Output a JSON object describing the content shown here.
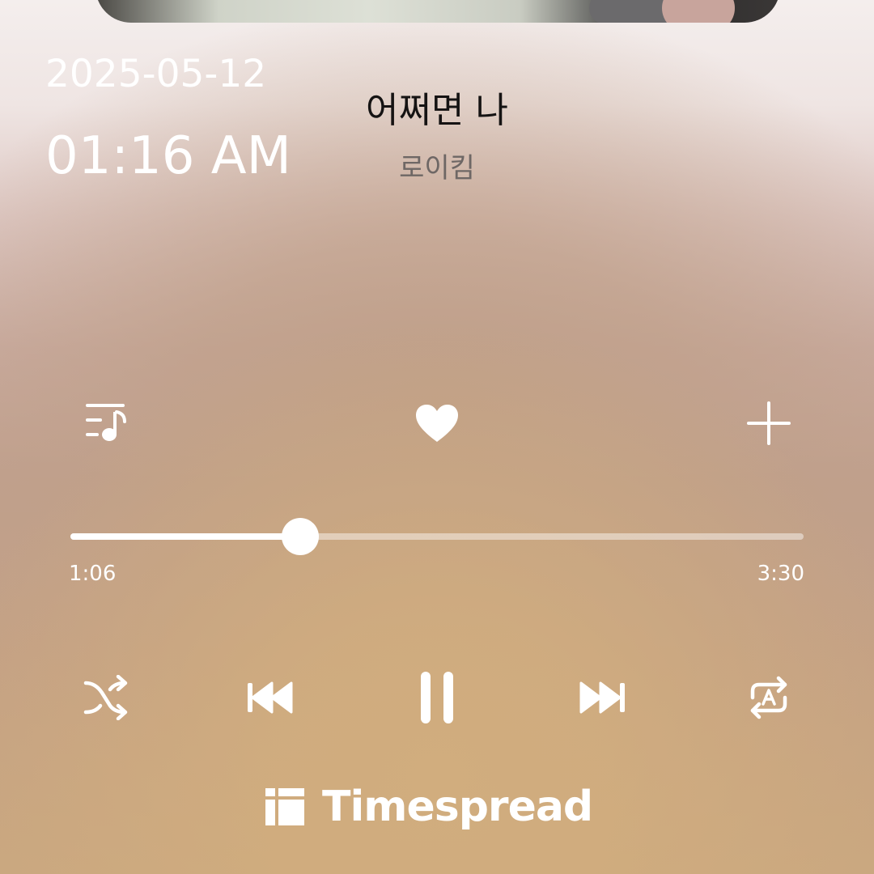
{
  "status": {
    "date": "2025-05-12",
    "time": "01:16 AM"
  },
  "track": {
    "title": "어쩌면 나",
    "artist": "로이킴",
    "liked": true
  },
  "playback": {
    "elapsed": "1:06",
    "duration": "3:30",
    "progress_fraction": 0.314,
    "state": "playing"
  },
  "icons": {
    "playlist": "playlist-music-icon",
    "like": "heart-icon",
    "add": "plus-icon",
    "shuffle": "shuffle-icon",
    "previous": "skip-previous-icon",
    "pause": "pause-icon",
    "next": "skip-next-icon",
    "repeat": "repeat-a-icon",
    "brand": "timespread-logo-icon"
  },
  "brand": {
    "name": "Timespread"
  },
  "colors": {
    "accent": "#ffffff",
    "title_text": "#151313",
    "artist_text": "#6e6765"
  }
}
